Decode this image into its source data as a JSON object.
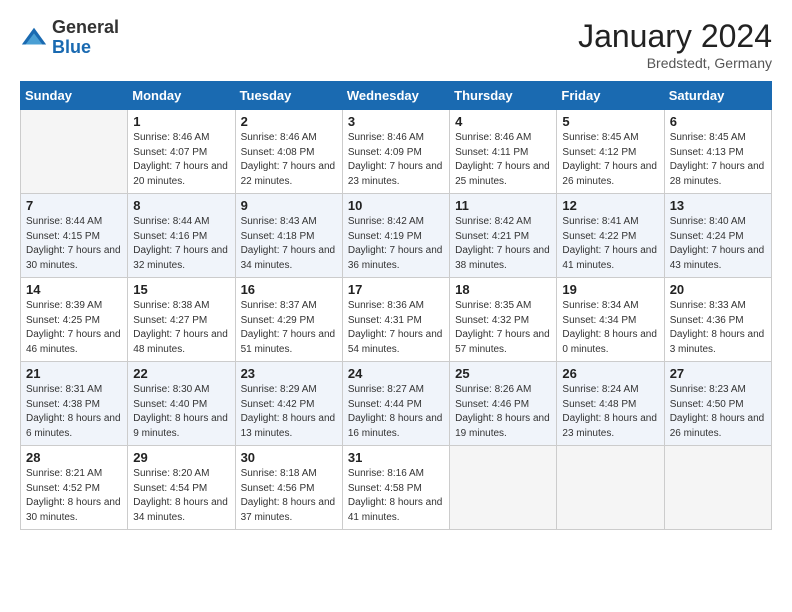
{
  "logo": {
    "general": "General",
    "blue": "Blue"
  },
  "title": "January 2024",
  "subtitle": "Bredstedt, Germany",
  "days_of_week": [
    "Sunday",
    "Monday",
    "Tuesday",
    "Wednesday",
    "Thursday",
    "Friday",
    "Saturday"
  ],
  "weeks": [
    [
      {
        "day": "",
        "empty": true
      },
      {
        "day": "1",
        "sunrise": "Sunrise: 8:46 AM",
        "sunset": "Sunset: 4:07 PM",
        "daylight": "Daylight: 7 hours and 20 minutes."
      },
      {
        "day": "2",
        "sunrise": "Sunrise: 8:46 AM",
        "sunset": "Sunset: 4:08 PM",
        "daylight": "Daylight: 7 hours and 22 minutes."
      },
      {
        "day": "3",
        "sunrise": "Sunrise: 8:46 AM",
        "sunset": "Sunset: 4:09 PM",
        "daylight": "Daylight: 7 hours and 23 minutes."
      },
      {
        "day": "4",
        "sunrise": "Sunrise: 8:46 AM",
        "sunset": "Sunset: 4:11 PM",
        "daylight": "Daylight: 7 hours and 25 minutes."
      },
      {
        "day": "5",
        "sunrise": "Sunrise: 8:45 AM",
        "sunset": "Sunset: 4:12 PM",
        "daylight": "Daylight: 7 hours and 26 minutes."
      },
      {
        "day": "6",
        "sunrise": "Sunrise: 8:45 AM",
        "sunset": "Sunset: 4:13 PM",
        "daylight": "Daylight: 7 hours and 28 minutes."
      }
    ],
    [
      {
        "day": "7",
        "sunrise": "Sunrise: 8:44 AM",
        "sunset": "Sunset: 4:15 PM",
        "daylight": "Daylight: 7 hours and 30 minutes."
      },
      {
        "day": "8",
        "sunrise": "Sunrise: 8:44 AM",
        "sunset": "Sunset: 4:16 PM",
        "daylight": "Daylight: 7 hours and 32 minutes."
      },
      {
        "day": "9",
        "sunrise": "Sunrise: 8:43 AM",
        "sunset": "Sunset: 4:18 PM",
        "daylight": "Daylight: 7 hours and 34 minutes."
      },
      {
        "day": "10",
        "sunrise": "Sunrise: 8:42 AM",
        "sunset": "Sunset: 4:19 PM",
        "daylight": "Daylight: 7 hours and 36 minutes."
      },
      {
        "day": "11",
        "sunrise": "Sunrise: 8:42 AM",
        "sunset": "Sunset: 4:21 PM",
        "daylight": "Daylight: 7 hours and 38 minutes."
      },
      {
        "day": "12",
        "sunrise": "Sunrise: 8:41 AM",
        "sunset": "Sunset: 4:22 PM",
        "daylight": "Daylight: 7 hours and 41 minutes."
      },
      {
        "day": "13",
        "sunrise": "Sunrise: 8:40 AM",
        "sunset": "Sunset: 4:24 PM",
        "daylight": "Daylight: 7 hours and 43 minutes."
      }
    ],
    [
      {
        "day": "14",
        "sunrise": "Sunrise: 8:39 AM",
        "sunset": "Sunset: 4:25 PM",
        "daylight": "Daylight: 7 hours and 46 minutes."
      },
      {
        "day": "15",
        "sunrise": "Sunrise: 8:38 AM",
        "sunset": "Sunset: 4:27 PM",
        "daylight": "Daylight: 7 hours and 48 minutes."
      },
      {
        "day": "16",
        "sunrise": "Sunrise: 8:37 AM",
        "sunset": "Sunset: 4:29 PM",
        "daylight": "Daylight: 7 hours and 51 minutes."
      },
      {
        "day": "17",
        "sunrise": "Sunrise: 8:36 AM",
        "sunset": "Sunset: 4:31 PM",
        "daylight": "Daylight: 7 hours and 54 minutes."
      },
      {
        "day": "18",
        "sunrise": "Sunrise: 8:35 AM",
        "sunset": "Sunset: 4:32 PM",
        "daylight": "Daylight: 7 hours and 57 minutes."
      },
      {
        "day": "19",
        "sunrise": "Sunrise: 8:34 AM",
        "sunset": "Sunset: 4:34 PM",
        "daylight": "Daylight: 8 hours and 0 minutes."
      },
      {
        "day": "20",
        "sunrise": "Sunrise: 8:33 AM",
        "sunset": "Sunset: 4:36 PM",
        "daylight": "Daylight: 8 hours and 3 minutes."
      }
    ],
    [
      {
        "day": "21",
        "sunrise": "Sunrise: 8:31 AM",
        "sunset": "Sunset: 4:38 PM",
        "daylight": "Daylight: 8 hours and 6 minutes."
      },
      {
        "day": "22",
        "sunrise": "Sunrise: 8:30 AM",
        "sunset": "Sunset: 4:40 PM",
        "daylight": "Daylight: 8 hours and 9 minutes."
      },
      {
        "day": "23",
        "sunrise": "Sunrise: 8:29 AM",
        "sunset": "Sunset: 4:42 PM",
        "daylight": "Daylight: 8 hours and 13 minutes."
      },
      {
        "day": "24",
        "sunrise": "Sunrise: 8:27 AM",
        "sunset": "Sunset: 4:44 PM",
        "daylight": "Daylight: 8 hours and 16 minutes."
      },
      {
        "day": "25",
        "sunrise": "Sunrise: 8:26 AM",
        "sunset": "Sunset: 4:46 PM",
        "daylight": "Daylight: 8 hours and 19 minutes."
      },
      {
        "day": "26",
        "sunrise": "Sunrise: 8:24 AM",
        "sunset": "Sunset: 4:48 PM",
        "daylight": "Daylight: 8 hours and 23 minutes."
      },
      {
        "day": "27",
        "sunrise": "Sunrise: 8:23 AM",
        "sunset": "Sunset: 4:50 PM",
        "daylight": "Daylight: 8 hours and 26 minutes."
      }
    ],
    [
      {
        "day": "28",
        "sunrise": "Sunrise: 8:21 AM",
        "sunset": "Sunset: 4:52 PM",
        "daylight": "Daylight: 8 hours and 30 minutes."
      },
      {
        "day": "29",
        "sunrise": "Sunrise: 8:20 AM",
        "sunset": "Sunset: 4:54 PM",
        "daylight": "Daylight: 8 hours and 34 minutes."
      },
      {
        "day": "30",
        "sunrise": "Sunrise: 8:18 AM",
        "sunset": "Sunset: 4:56 PM",
        "daylight": "Daylight: 8 hours and 37 minutes."
      },
      {
        "day": "31",
        "sunrise": "Sunrise: 8:16 AM",
        "sunset": "Sunset: 4:58 PM",
        "daylight": "Daylight: 8 hours and 41 minutes."
      },
      {
        "day": "",
        "empty": true
      },
      {
        "day": "",
        "empty": true
      },
      {
        "day": "",
        "empty": true
      }
    ]
  ]
}
